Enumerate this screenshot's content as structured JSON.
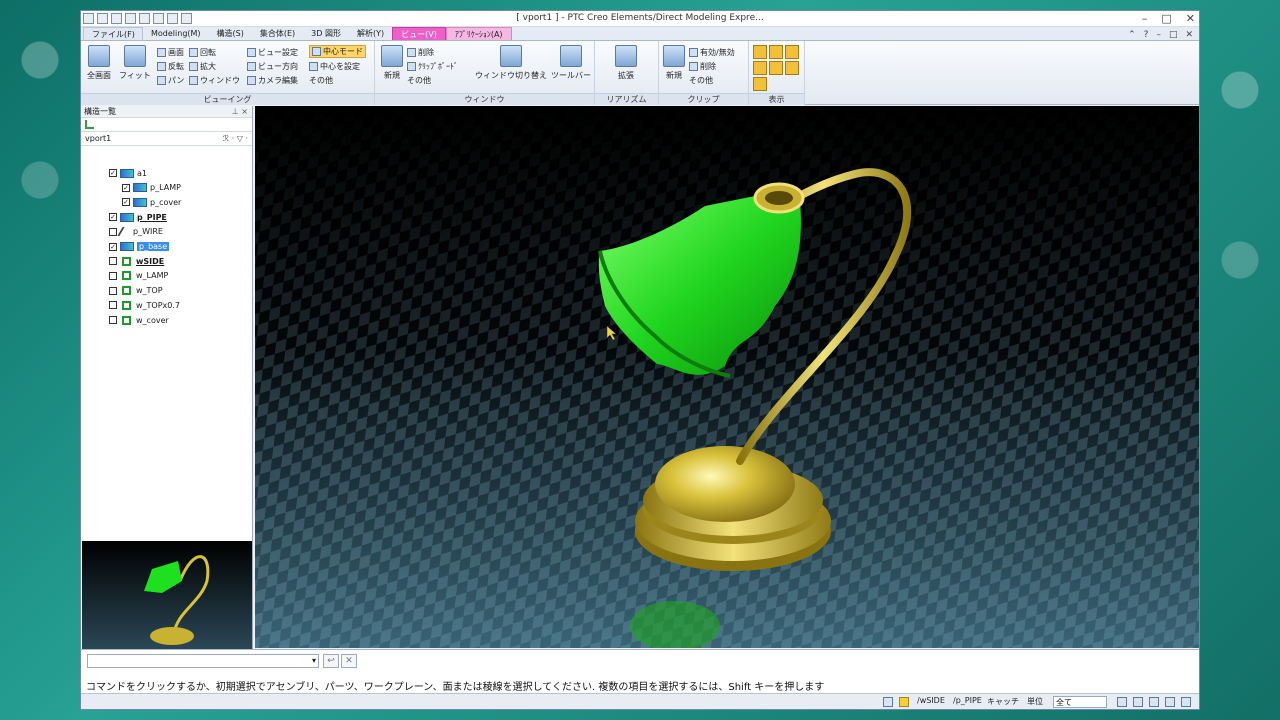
{
  "window": {
    "title": "[ vport1 ] - PTC Creo Elements/Direct Modeling Expre...",
    "controls": [
      "–",
      "□",
      "✕"
    ]
  },
  "tabs": [
    {
      "label": "ファイル(F)",
      "kind": "file"
    },
    {
      "label": "Modeling(M)",
      "kind": "normal"
    },
    {
      "label": "構造(S)",
      "kind": "normal"
    },
    {
      "label": "集合体(E)",
      "kind": "normal"
    },
    {
      "label": "3D 図形",
      "kind": "normal"
    },
    {
      "label": "解析(Y)",
      "kind": "normal"
    },
    {
      "label": "ビュー(V)",
      "kind": "active"
    },
    {
      "label": "ｱﾌﾟﾘｹｰｼｮﾝ(A)",
      "kind": "app"
    }
  ],
  "tab_right": {
    "up": "⌃",
    "help": "?",
    "min": "–",
    "restore": "□",
    "close": "✕"
  },
  "ribbon": {
    "viewing": {
      "label": "ビューイング",
      "fullscreen": "全画面",
      "fit": "フィット",
      "prev": "画面",
      "rotate": "回転",
      "reverse": "反転",
      "zoom": "拡大",
      "pan": "パン",
      "window": "ウィンドウ",
      "view_settings": "ビュー設定",
      "view_direction": "ビュー方向",
      "camera_edit": "カメラ編集",
      "center_mode": "中心モード",
      "set_center": "中心を設定",
      "other": "その他"
    },
    "window": {
      "label": "ウィンドウ",
      "new": "新規",
      "delete": "削除",
      "clipboard": "ｸﾘｯﾌﾟﾎﾞｰﾄﾞ",
      "other": "その他",
      "switch": "ウィンドウ切り替え",
      "toolbar": "ツールバー"
    },
    "realism": {
      "label": "リアリズム",
      "extend": "拡張"
    },
    "clip": {
      "label": "クリップ",
      "new": "新規",
      "enable": "有効/無効",
      "delete": "削除",
      "other": "その他"
    },
    "display": {
      "label": "表示"
    }
  },
  "panel": {
    "header": "構造一覧",
    "pin": "⊥ ×",
    "vport": "vport1",
    "vport_tools": "ℛ · ▽ ·",
    "tree": [
      {
        "label": "a1",
        "checked": true,
        "type": "assembly",
        "indent": 0,
        "style": ""
      },
      {
        "label": "p_LAMP",
        "checked": true,
        "type": "part",
        "indent": 1,
        "style": ""
      },
      {
        "label": "p_cover",
        "checked": true,
        "type": "part",
        "indent": 1,
        "style": ""
      },
      {
        "label": "p_PIPE",
        "checked": true,
        "type": "part",
        "indent": 0,
        "style": "bold"
      },
      {
        "label": "p_WIRE",
        "checked": false,
        "type": "wire",
        "indent": 0,
        "style": ""
      },
      {
        "label": "p_base",
        "checked": true,
        "type": "part",
        "indent": 0,
        "style": "sel"
      },
      {
        "label": "wSIDE",
        "checked": false,
        "type": "workplane",
        "indent": 0,
        "style": "bold"
      },
      {
        "label": "w_LAMP",
        "checked": false,
        "type": "workplane",
        "indent": 0,
        "style": ""
      },
      {
        "label": "w_TOP",
        "checked": false,
        "type": "workplane",
        "indent": 0,
        "style": ""
      },
      {
        "label": "w_TOPx0.7",
        "checked": false,
        "type": "workplane",
        "indent": 0,
        "style": ""
      },
      {
        "label": "w_cover",
        "checked": false,
        "type": "workplane",
        "indent": 0,
        "style": ""
      }
    ]
  },
  "command": {
    "input_value": "",
    "prompt": "コマンドをクリックするか、初期選択でアセンブリ、パーツ、ワークプレーン、面または稜線を選択してください. 複数の項目を選択するには、Shift キーを押します"
  },
  "status": {
    "workplane": "/wSIDE",
    "part": "/p_PIPE",
    "cache": "キャッチ",
    "unit": "単位",
    "filter": "全て"
  },
  "colors": {
    "accent_tab": "#ee5fc9",
    "lamp_shade": "#1ee01e",
    "brass": "#d8c23a",
    "selection": "#3b8ee8"
  }
}
